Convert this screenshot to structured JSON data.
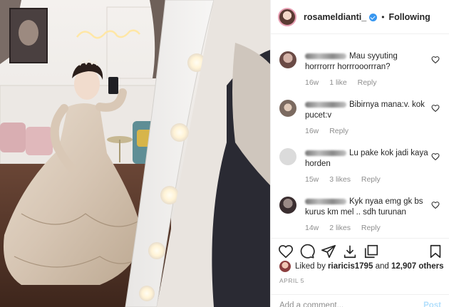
{
  "header": {
    "username": "rosameldianti_",
    "separator": "•",
    "follow_status": "Following"
  },
  "comments": [
    {
      "text": "Mau syyuting horrrorrr horrrooorrran?",
      "time": "16w",
      "likes": "1 like",
      "reply": "Reply"
    },
    {
      "text": "Bibirnya mana:v. kok pucet:v",
      "time": "16w",
      "likes": "",
      "reply": "Reply"
    },
    {
      "text": "Lu pake kok jadi kaya horden",
      "time": "15w",
      "likes": "3 likes",
      "reply": "Reply"
    },
    {
      "text": "Kyk nyaa emg gk bs kurus km mel .. sdh turunan",
      "time": "14w",
      "likes": "2 likes",
      "reply": "Reply"
    }
  ],
  "likes": {
    "prefix": "Liked by",
    "user": "riaricis1795",
    "conjunction": "and",
    "count": "12,907 others"
  },
  "post_date": "APRIL 5",
  "comment_box": {
    "placeholder": "Add a comment...",
    "post_label": "Post"
  },
  "icons": [
    "heart-icon",
    "comment-icon",
    "share-icon",
    "download-icon",
    "copy-icon",
    "bookmark-icon"
  ],
  "colors": {
    "verified": "#3897f0",
    "post_disabled": "#b2dffc",
    "muted": "#8e8e8e"
  }
}
